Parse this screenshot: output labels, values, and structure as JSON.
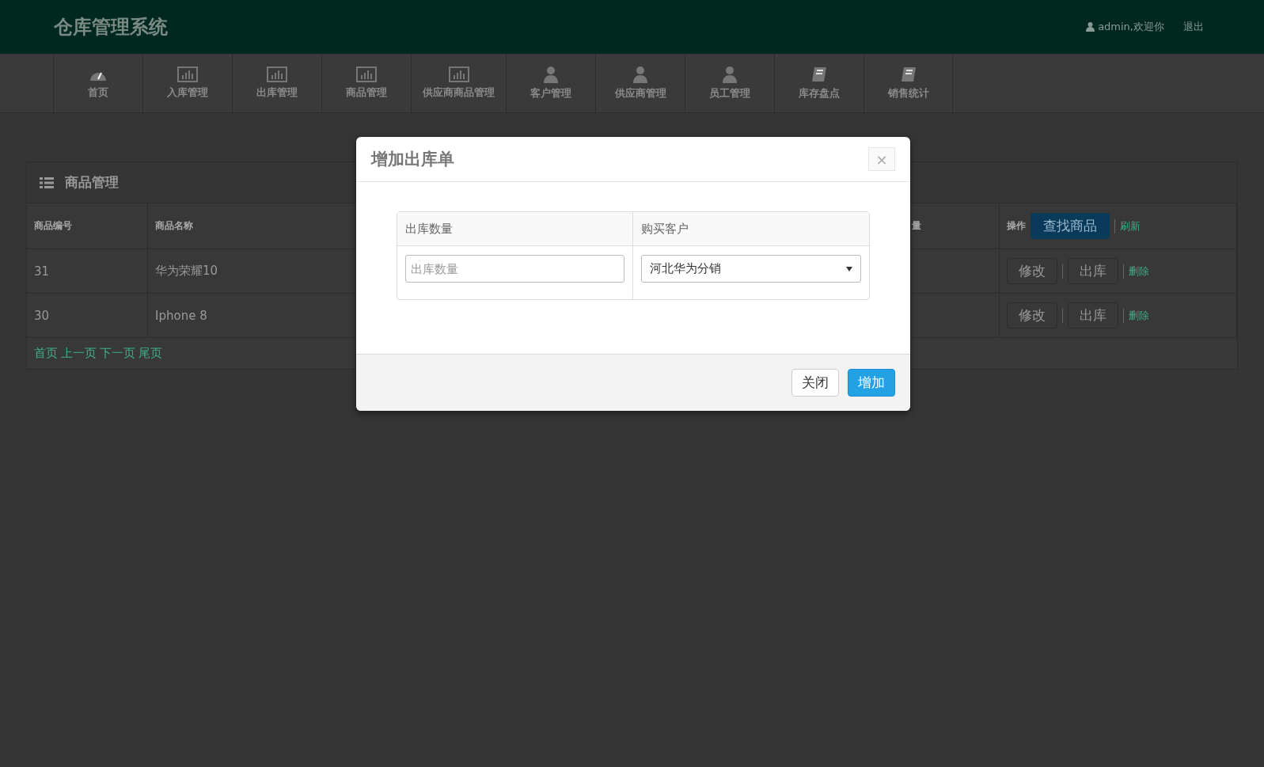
{
  "header": {
    "title": "仓库管理系统",
    "user": "admin,欢迎你",
    "logout": "退出"
  },
  "nav": [
    {
      "label": "首页",
      "kind": "dashboard"
    },
    {
      "label": "入库管理",
      "kind": "chart"
    },
    {
      "label": "出库管理",
      "kind": "chart"
    },
    {
      "label": "商品管理",
      "kind": "chart"
    },
    {
      "label": "供应商商品管理",
      "kind": "chart"
    },
    {
      "label": "客户管理",
      "kind": "person"
    },
    {
      "label": "供应商管理",
      "kind": "person"
    },
    {
      "label": "员工管理",
      "kind": "person"
    },
    {
      "label": "库存盘点",
      "kind": "book"
    },
    {
      "label": "销售统计",
      "kind": "book"
    }
  ],
  "panel": {
    "title": "商品管理",
    "columns": [
      "商品编号",
      "商品名称",
      "量",
      "操作"
    ],
    "search_button": "查找商品",
    "refresh": "刷新",
    "rows": [
      {
        "id": "31",
        "name": "华为荣耀10",
        "actions": [
          "修改",
          "出库"
        ],
        "delete": "删除"
      },
      {
        "id": "30",
        "name": "Iphone 8",
        "actions": [
          "修改",
          "出库"
        ],
        "delete": "删除"
      }
    ],
    "pager": [
      "首页",
      "上一页",
      "下一页",
      "尾页"
    ]
  },
  "modal": {
    "title": "增加出库单",
    "close_icon": "×",
    "fields": [
      {
        "label": "出库数量",
        "kind": "input",
        "placeholder": "出库数量"
      },
      {
        "label": "购买客户",
        "kind": "select",
        "value": "河北华为分销"
      }
    ],
    "buttons": [
      {
        "label": "关闭",
        "kind": "default"
      },
      {
        "label": "增加",
        "kind": "primary"
      }
    ]
  }
}
